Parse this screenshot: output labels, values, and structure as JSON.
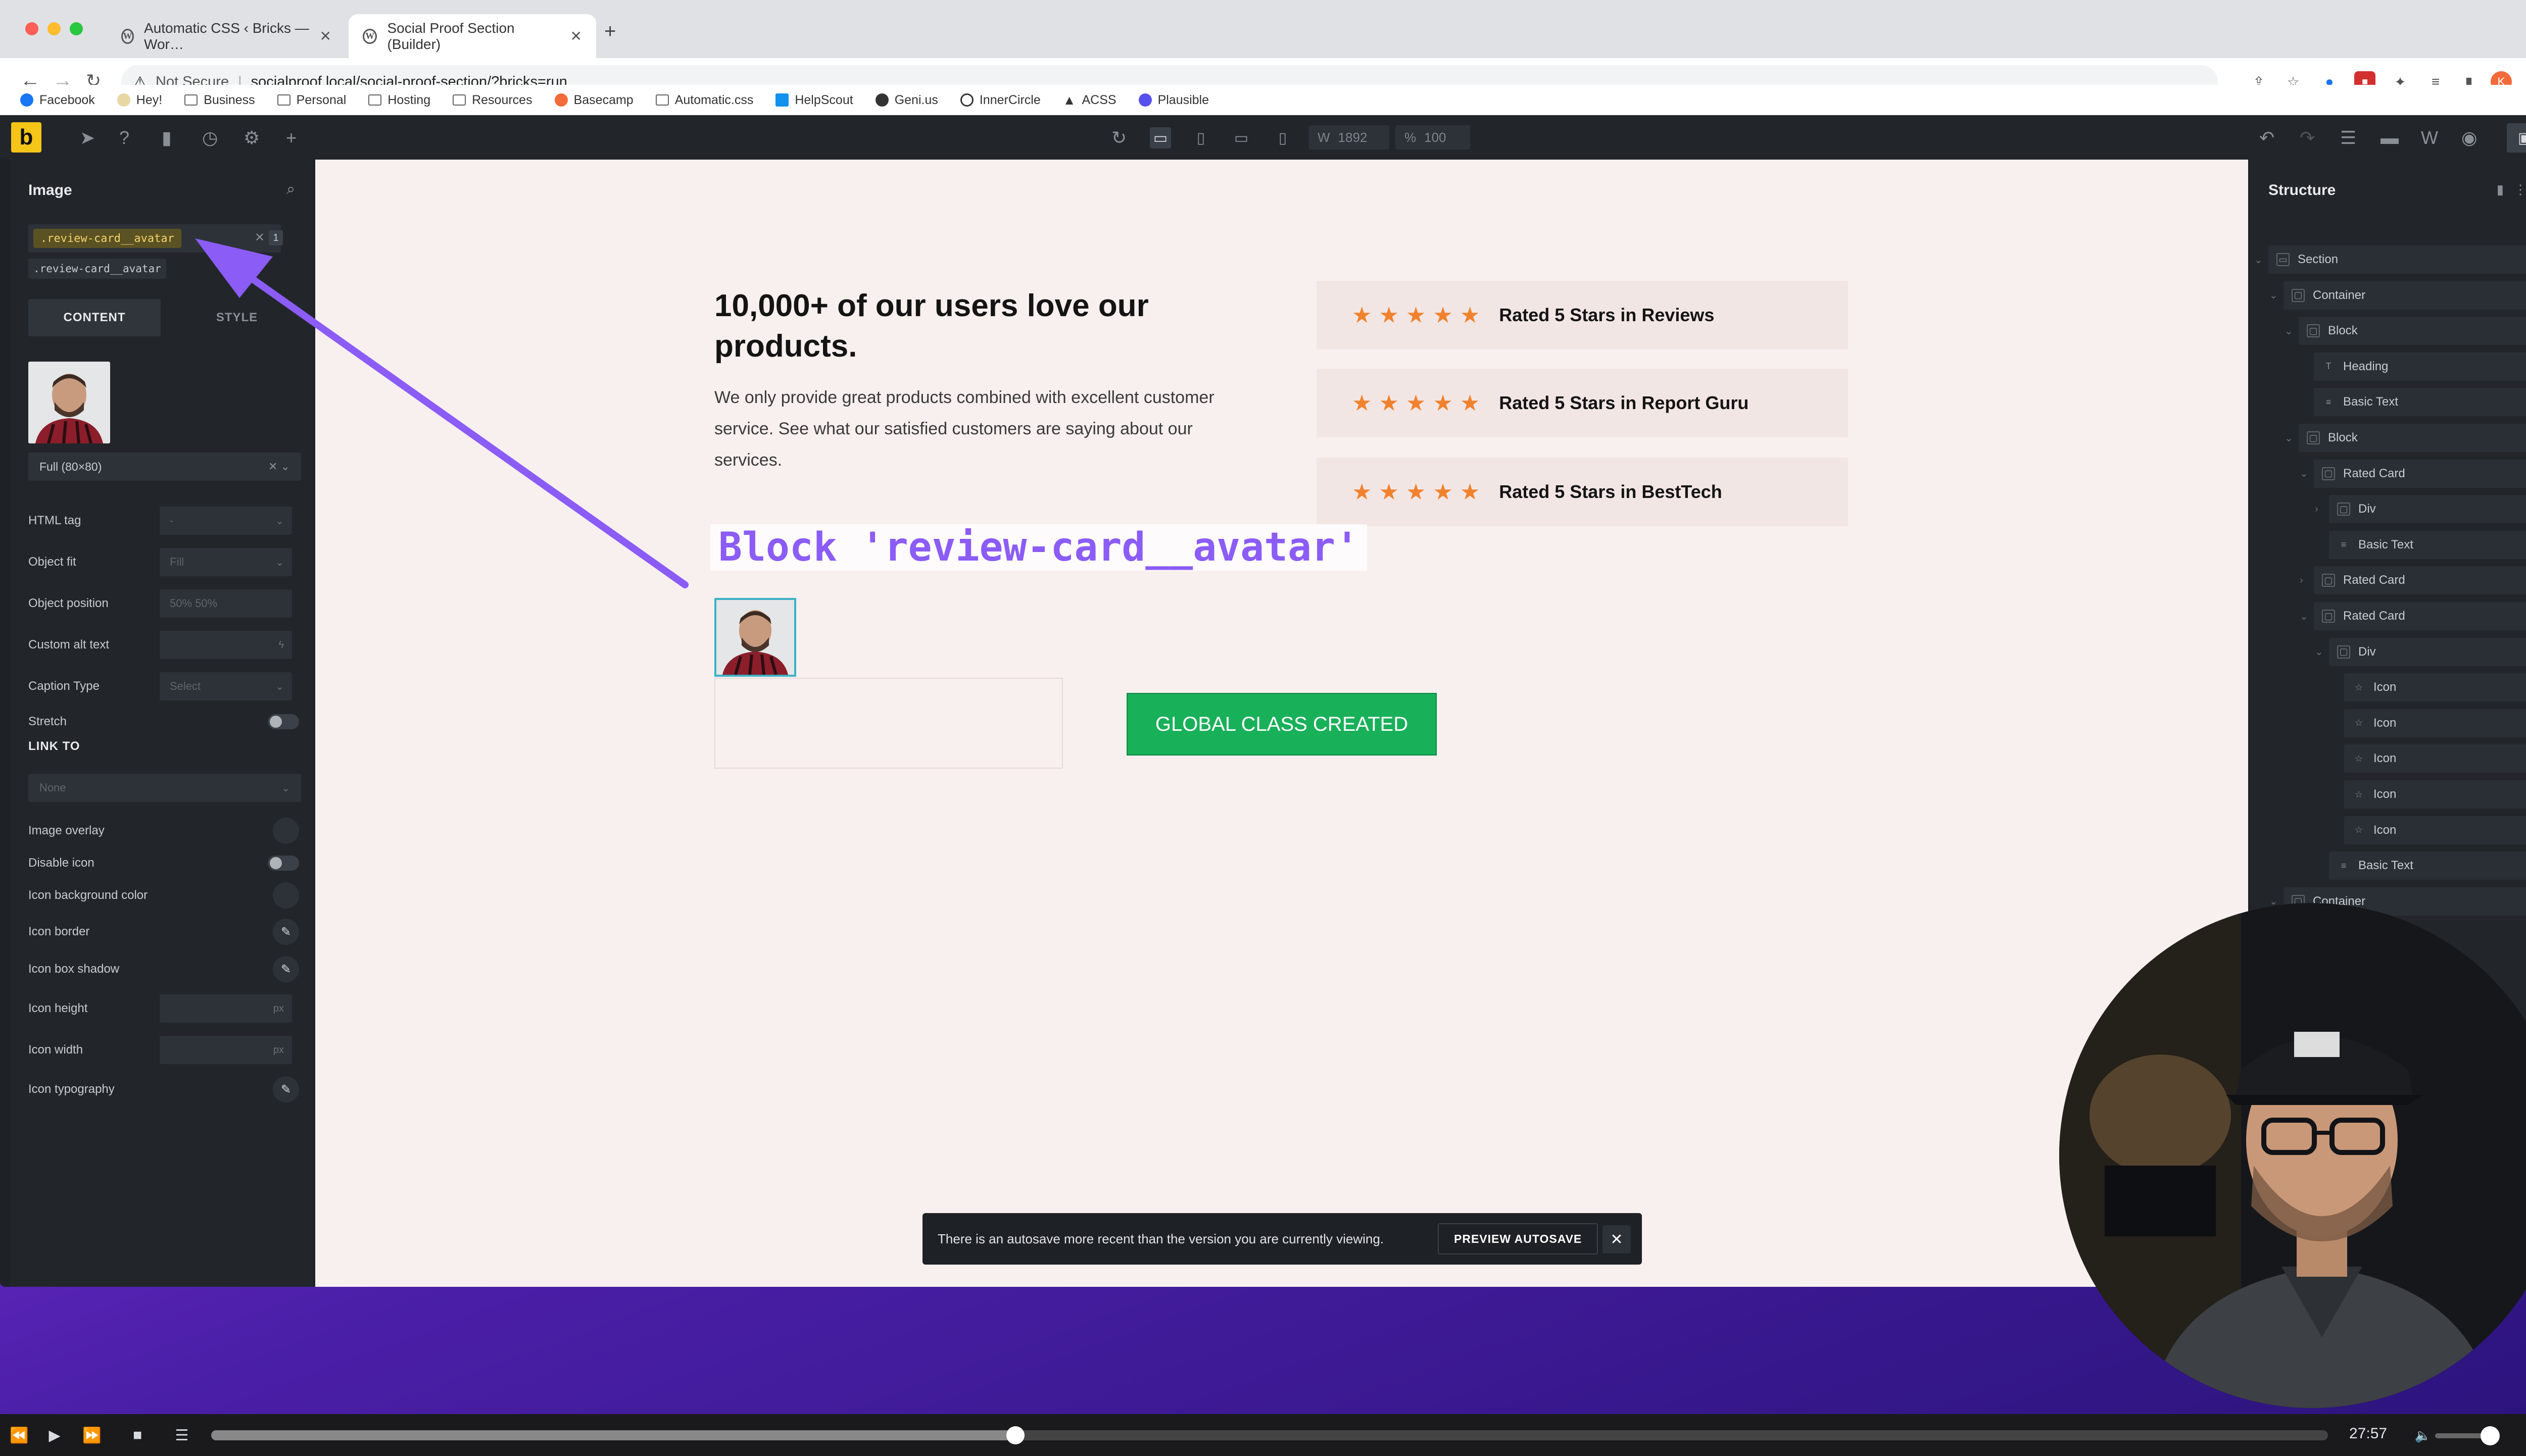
{
  "browser": {
    "tabs": [
      {
        "title": "Automatic CSS ‹ Bricks — Wor…",
        "active": false
      },
      {
        "title": "Social Proof Section (Builder)",
        "active": true
      }
    ],
    "new_tab": "+",
    "security": "Not Secure",
    "url": "socialproof.local/social-proof-section/?bricks=run",
    "bookmarks": [
      "Facebook",
      "Hey!",
      "Business",
      "Personal",
      "Hosting",
      "Resources",
      "Basecamp",
      "Automatic.css",
      "HelpScout",
      "Geni.us",
      "InnerCircle",
      "ACSS",
      "Plausible"
    ]
  },
  "toolbar": {
    "logo": "b",
    "width_label": "W",
    "width_value": "1892",
    "zoom_label": "%",
    "zoom_value": "100"
  },
  "left_panel": {
    "title": "Image",
    "class_chip": ".review-card__avatar",
    "class_count": "1",
    "class_sub": ".review-card__avatar",
    "tabs": [
      "CONTENT",
      "STYLE"
    ],
    "size_value": "Full (80×80)",
    "rows": [
      {
        "label": "HTML tag",
        "value": "-"
      },
      {
        "label": "Object fit",
        "value": "Fill"
      },
      {
        "label": "Object position",
        "value": "50% 50%"
      },
      {
        "label": "Custom alt text",
        "value": ""
      },
      {
        "label": "Caption Type",
        "value": "Select"
      }
    ],
    "stretch_label": "Stretch",
    "link_to_heading": "LINK TO",
    "link_to_value": "None",
    "options": [
      {
        "label": "Image overlay"
      },
      {
        "label": "Disable icon"
      },
      {
        "label": "Icon background color"
      },
      {
        "label": "Icon border"
      },
      {
        "label": "Icon box shadow"
      },
      {
        "label": "Icon height",
        "unit": "px"
      },
      {
        "label": "Icon width",
        "unit": "px"
      },
      {
        "label": "Icon typography"
      }
    ]
  },
  "canvas": {
    "heading": "10,000+ of our users love our products.",
    "body": "We only provide great products combined with excellent customer service. See what our satisfied customers are saying about our services.",
    "rated_cards": [
      {
        "label": "Rated 5 Stars in Reviews",
        "stars": 5
      },
      {
        "label": "Rated 5 Stars in Report Guru",
        "stars": 5
      },
      {
        "label": "Rated 5 Stars in BestTech",
        "stars": 5
      }
    ],
    "annotation": "Block 'review-card__avatar'",
    "global_class_button": "GLOBAL CLASS CREATED",
    "autosave_message": "There is an autosave more recent than the version you are currently viewing.",
    "autosave_button": "PREVIEW AUTOSAVE"
  },
  "structure": {
    "title": "Structure",
    "nodes": [
      {
        "label": "Section",
        "icon": "section-icon"
      },
      {
        "label": "Container",
        "icon": "container-icon"
      },
      {
        "label": "Block",
        "icon": "block-icon"
      },
      {
        "label": "Heading",
        "icon": "heading-icon"
      },
      {
        "label": "Basic Text",
        "icon": "text-icon"
      },
      {
        "label": "Block",
        "icon": "block-icon"
      },
      {
        "label": "Rated Card",
        "icon": "block-icon"
      },
      {
        "label": "Div",
        "icon": "div-icon"
      },
      {
        "label": "Basic Text",
        "icon": "text-icon"
      },
      {
        "label": "Rated Card",
        "icon": "block-icon"
      },
      {
        "label": "Rated Card",
        "icon": "block-icon"
      },
      {
        "label": "Div",
        "icon": "div-icon"
      },
      {
        "label": "Icon",
        "icon": "star-icon"
      },
      {
        "label": "Icon",
        "icon": "star-icon"
      },
      {
        "label": "Icon",
        "icon": "star-icon"
      },
      {
        "label": "Icon",
        "icon": "star-icon"
      },
      {
        "label": "Icon",
        "icon": "star-icon"
      },
      {
        "label": "Basic Text",
        "icon": "text-icon"
      },
      {
        "label": "Container",
        "icon": "container-icon"
      }
    ]
  },
  "video": {
    "time": "27:57",
    "progress": 0.38
  },
  "colors": {
    "accent_purple": "#8b5cf6",
    "button_green": "#19b05a",
    "star_orange": "#f0822e",
    "bricks_yellow": "#f5c518"
  }
}
